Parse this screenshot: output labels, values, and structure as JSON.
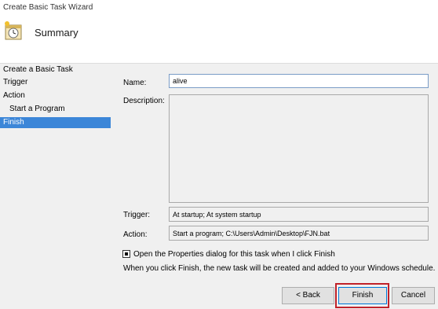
{
  "window": {
    "title": "Create Basic Task Wizard"
  },
  "header": {
    "title": "Summary",
    "icon": "task-scheduler-clock-icon"
  },
  "nav": {
    "items": [
      {
        "label": "Create a Basic Task"
      },
      {
        "label": "Trigger"
      },
      {
        "label": "Action"
      },
      {
        "label": "Start a Program"
      },
      {
        "label": "Finish"
      }
    ]
  },
  "form": {
    "name_label": "Name:",
    "name_value": "alive",
    "description_label": "Description:",
    "description_value": "",
    "trigger_label": "Trigger:",
    "trigger_value": "At startup; At system startup",
    "action_label": "Action:",
    "action_value": "Start a program; C:\\Users\\Admin\\Desktop\\FJN.bat",
    "open_properties_label": "Open the Properties dialog for this task when I click Finish",
    "open_properties_checked": true,
    "info_text": "When you click Finish, the new task will be created and added to your Windows schedule."
  },
  "buttons": {
    "back": "< Back",
    "finish": "Finish",
    "cancel": "Cancel"
  },
  "colors": {
    "selection": "#3c86d8",
    "highlight_border": "#c0222a"
  }
}
